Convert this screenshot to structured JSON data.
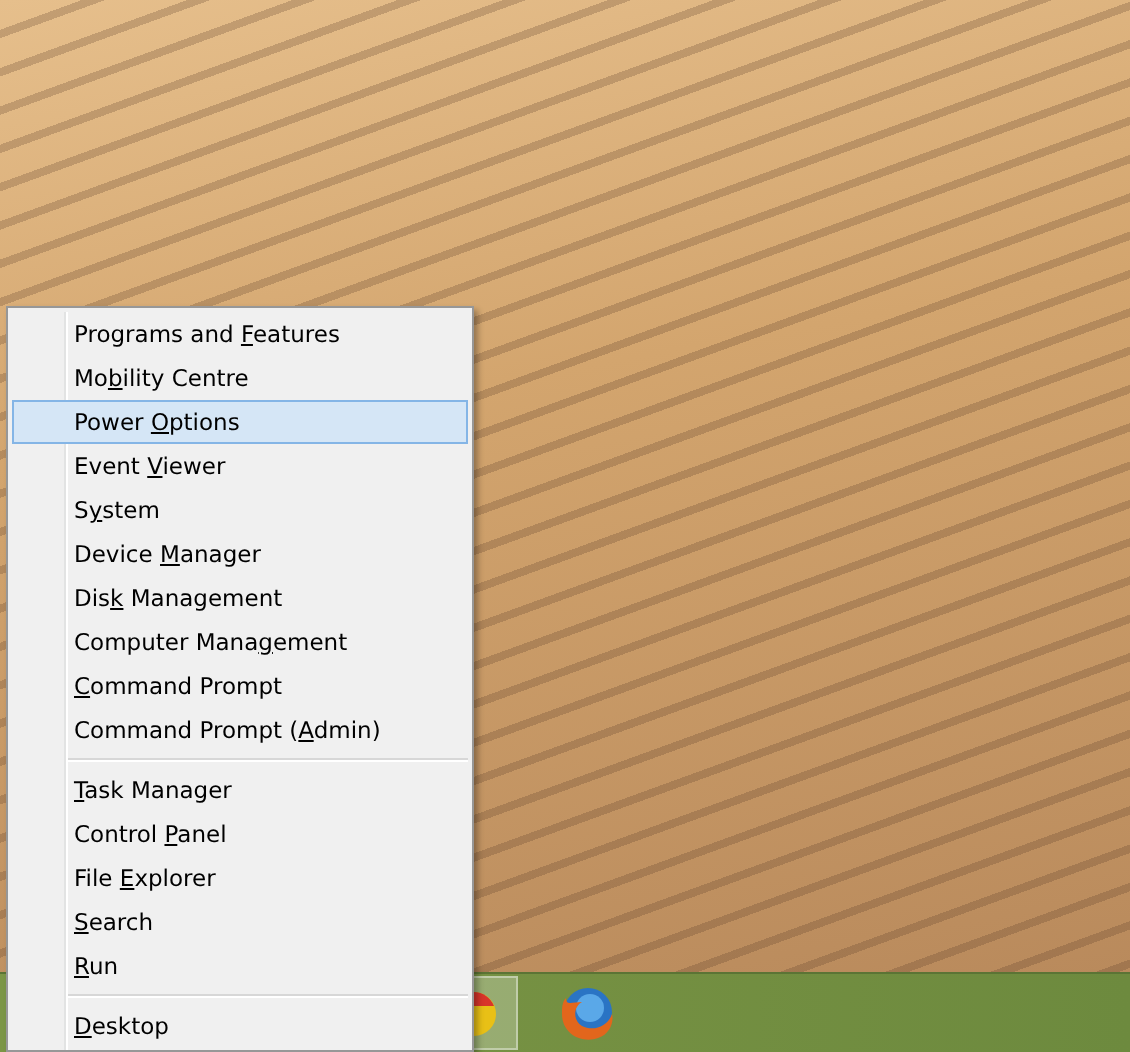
{
  "menu": {
    "groups": [
      {
        "items": [
          {
            "before": "Programs and ",
            "key": "F",
            "after": "eatures",
            "selected": false
          },
          {
            "before": "Mo",
            "key": "b",
            "after": "ility Centre",
            "selected": false
          },
          {
            "before": "Power ",
            "key": "O",
            "after": "ptions",
            "selected": true
          },
          {
            "before": "Event ",
            "key": "V",
            "after": "iewer",
            "selected": false
          },
          {
            "before": "S",
            "key": "y",
            "after": "stem",
            "selected": false
          },
          {
            "before": "Device ",
            "key": "M",
            "after": "anager",
            "selected": false
          },
          {
            "before": "Dis",
            "key": "k",
            "after": " Management",
            "selected": false
          },
          {
            "before": "Computer Mana",
            "key": "g",
            "after": "ement",
            "selected": false
          },
          {
            "key": "C",
            "after": "ommand Prompt",
            "selected": false
          },
          {
            "before": "Command Prompt (",
            "key": "A",
            "after": "dmin)",
            "selected": false
          }
        ]
      },
      {
        "items": [
          {
            "key": "T",
            "after": "ask Manager",
            "selected": false
          },
          {
            "before": "Control ",
            "key": "P",
            "after": "anel",
            "selected": false
          },
          {
            "before": "File ",
            "key": "E",
            "after": "xplorer",
            "selected": false
          },
          {
            "key": "S",
            "after": "earch",
            "selected": false
          },
          {
            "key": "R",
            "after": "un",
            "selected": false
          }
        ]
      },
      {
        "items": [
          {
            "key": "D",
            "after": "esktop",
            "selected": false
          }
        ]
      }
    ]
  }
}
